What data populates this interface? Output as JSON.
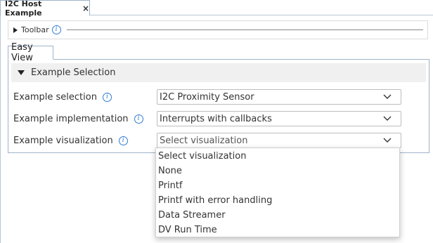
{
  "editor": {
    "tab_label": "I2C Host Example",
    "tab_close": "×"
  },
  "toolbar": {
    "label": "Toolbar"
  },
  "view_tabs": [
    {
      "label": "Easy View"
    }
  ],
  "section": {
    "title": "Example Selection"
  },
  "fields": [
    {
      "label": "Example selection",
      "value": "I2C Proximity Sensor",
      "info_icon": "info-icon"
    },
    {
      "label": "Example implementation",
      "value": "Interrupts with callbacks",
      "info_icon": "info-icon"
    },
    {
      "label": "Example visualization",
      "value": "Select visualization",
      "info_icon": "info-icon"
    }
  ],
  "visualization_dropdown": {
    "open": true,
    "options": [
      "Select visualization",
      "None",
      "Printf",
      "Printf with error handling",
      "Data Streamer",
      "DV Run Time"
    ]
  },
  "colors": {
    "info_icon": "#2f7cd6",
    "tab_border": "#9fb3c8",
    "section_header_bg": "#f0f0f0"
  }
}
